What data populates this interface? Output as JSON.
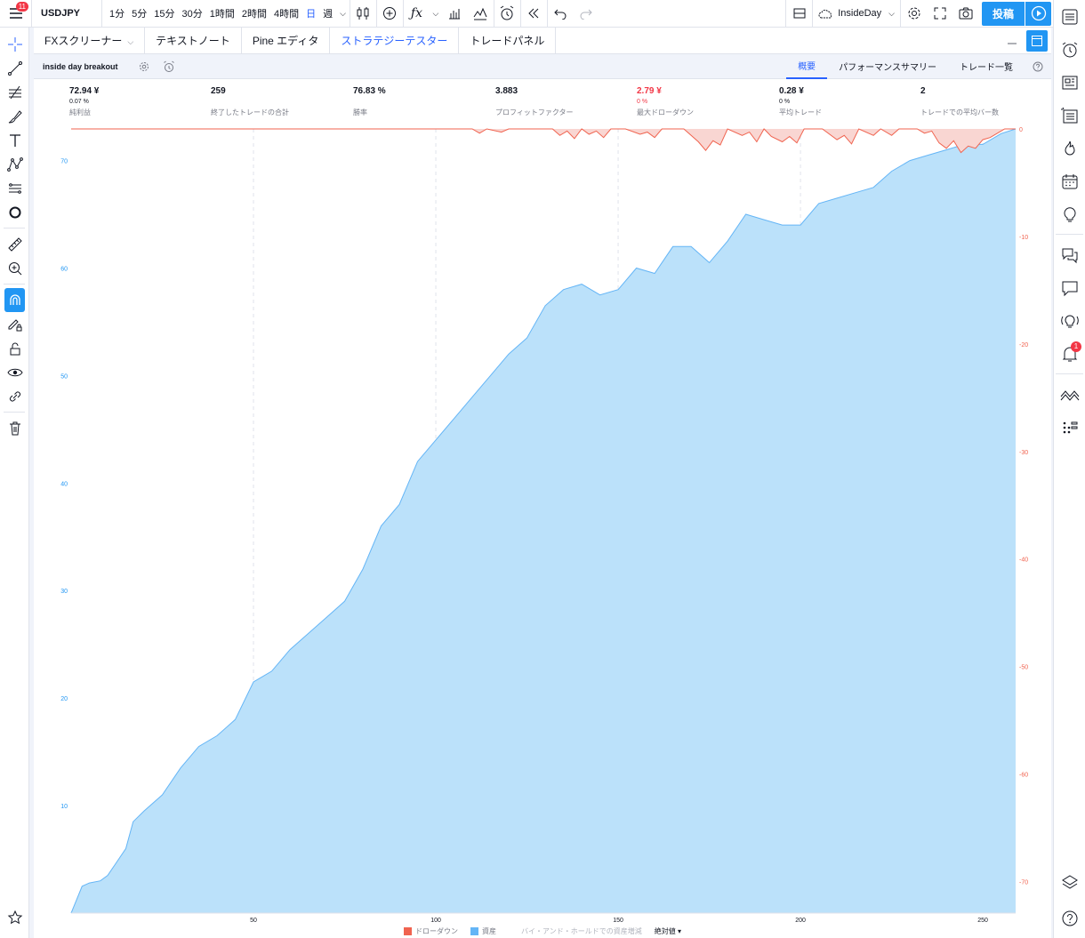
{
  "topbar": {
    "menu_badge": "11",
    "symbol": "USDJPY",
    "intervals": [
      "1分",
      "5分",
      "15分",
      "30分",
      "1時間",
      "2時間",
      "4時間",
      "日",
      "週"
    ],
    "active_interval": "日",
    "layout_name": "InsideDay",
    "publish_label": "投稿"
  },
  "panel": {
    "tabs": [
      {
        "label": "FXスクリーナー",
        "active": false,
        "dropdown": true
      },
      {
        "label": "テキストノート",
        "active": false
      },
      {
        "label": "Pine エディタ",
        "active": false
      },
      {
        "label": "ストラテジーテスター",
        "active": true
      },
      {
        "label": "トレードパネル",
        "active": false
      }
    ],
    "strategy_name": "inside day breakout",
    "subtabs": [
      {
        "label": "概要",
        "active": true
      },
      {
        "label": "パフォーマンスサマリー",
        "active": false
      },
      {
        "label": "トレード一覧",
        "active": false
      }
    ]
  },
  "stats": [
    {
      "value": "72.94 ¥",
      "sub": "0.07 %",
      "label": "純利益",
      "negative": false
    },
    {
      "value": "259",
      "sub": "",
      "label": "終了したトレードの合計",
      "negative": false
    },
    {
      "value": "76.83 %",
      "sub": "",
      "label": "勝率",
      "negative": false
    },
    {
      "value": "3.883",
      "sub": "",
      "label": "プロフィットファクター",
      "negative": false
    },
    {
      "value": "2.79 ¥",
      "sub": "0 %",
      "label": "最大ドローダウン",
      "negative": true
    },
    {
      "value": "0.28 ¥",
      "sub": "0 %",
      "label": "平均トレード",
      "negative": false
    },
    {
      "value": "2",
      "sub": "",
      "label": "トレードでの平均バー数",
      "negative": false
    }
  ],
  "legend": {
    "drawdown": "ドローダウン",
    "equity": "資産",
    "buyhold": "バイ・アンド・ホールドでの資産増減",
    "mode": "絶対値",
    "drawdown_color": "#f0634f",
    "equity_color": "#64b5f6"
  },
  "right_badge": "1",
  "chart_data": {
    "type": "area",
    "x_ticks": [
      50,
      100,
      150,
      200,
      250
    ],
    "xlim": [
      0,
      259
    ],
    "left_axis": {
      "ticks": [
        10,
        20,
        30,
        40,
        50,
        60,
        70
      ],
      "ylim": [
        0,
        72.94
      ]
    },
    "right_axis": {
      "ticks": [
        0,
        -10,
        -20,
        -30,
        -40,
        -50,
        -60,
        -70
      ],
      "ylim": [
        -72.94,
        0
      ]
    },
    "series": [
      {
        "name": "資産",
        "color": "#64b5f6",
        "points": [
          [
            0,
            0
          ],
          [
            3,
            2.5
          ],
          [
            5,
            2.8
          ],
          [
            8,
            3
          ],
          [
            10,
            3.5
          ],
          [
            12,
            4.5
          ],
          [
            15,
            6
          ],
          [
            17,
            8.5
          ],
          [
            20,
            9.5
          ],
          [
            25,
            11
          ],
          [
            30,
            13.5
          ],
          [
            35,
            15.5
          ],
          [
            40,
            16.5
          ],
          [
            45,
            18
          ],
          [
            50,
            21.5
          ],
          [
            55,
            22.5
          ],
          [
            60,
            24.5
          ],
          [
            65,
            26
          ],
          [
            70,
            27.5
          ],
          [
            75,
            29
          ],
          [
            80,
            32
          ],
          [
            85,
            36
          ],
          [
            90,
            38
          ],
          [
            95,
            42
          ],
          [
            100,
            44
          ],
          [
            105,
            46
          ],
          [
            110,
            48
          ],
          [
            115,
            50
          ],
          [
            120,
            52
          ],
          [
            125,
            53.5
          ],
          [
            130,
            56.5
          ],
          [
            135,
            58
          ],
          [
            140,
            58.5
          ],
          [
            145,
            57.5
          ],
          [
            150,
            58
          ],
          [
            155,
            60
          ],
          [
            160,
            59.5
          ],
          [
            165,
            62
          ],
          [
            170,
            62
          ],
          [
            175,
            60.5
          ],
          [
            180,
            62.5
          ],
          [
            185,
            65
          ],
          [
            190,
            64.5
          ],
          [
            195,
            64
          ],
          [
            200,
            64
          ],
          [
            205,
            66
          ],
          [
            210,
            66.5
          ],
          [
            215,
            67
          ],
          [
            220,
            67.5
          ],
          [
            225,
            69
          ],
          [
            230,
            70
          ],
          [
            235,
            70.5
          ],
          [
            240,
            71
          ],
          [
            245,
            71.5
          ],
          [
            250,
            71.5
          ],
          [
            255,
            72.5
          ],
          [
            259,
            72.94
          ]
        ]
      },
      {
        "name": "ドローダウン",
        "color": "#f0634f",
        "points": [
          [
            0,
            0
          ],
          [
            110,
            0
          ],
          [
            112,
            -0.4
          ],
          [
            114,
            0
          ],
          [
            118,
            -0.3
          ],
          [
            120,
            0
          ],
          [
            132,
            0
          ],
          [
            134,
            -0.6
          ],
          [
            136,
            -0.2
          ],
          [
            138,
            -0.9
          ],
          [
            140,
            0
          ],
          [
            142,
            -0.5
          ],
          [
            144,
            -0.2
          ],
          [
            146,
            -0.8
          ],
          [
            148,
            0
          ],
          [
            152,
            0
          ],
          [
            156,
            -0.5
          ],
          [
            158,
            -0.3
          ],
          [
            160,
            -0.8
          ],
          [
            162,
            0
          ],
          [
            168,
            0
          ],
          [
            172,
            -1.2
          ],
          [
            174,
            -2
          ],
          [
            176,
            -1.1
          ],
          [
            178,
            -1.5
          ],
          [
            180,
            0
          ],
          [
            184,
            -0.6
          ],
          [
            186,
            -0.3
          ],
          [
            188,
            -1.2
          ],
          [
            190,
            0
          ],
          [
            192,
            -0.7
          ],
          [
            195,
            -1.2
          ],
          [
            197,
            -0.7
          ],
          [
            199,
            -1.3
          ],
          [
            201,
            0
          ],
          [
            206,
            0
          ],
          [
            210,
            -1
          ],
          [
            212,
            -0.6
          ],
          [
            214,
            -1.4
          ],
          [
            216,
            0
          ],
          [
            220,
            -0.6
          ],
          [
            222,
            0
          ],
          [
            225,
            -0.6
          ],
          [
            227,
            0
          ],
          [
            232,
            0
          ],
          [
            234,
            -0.4
          ],
          [
            236,
            -0.2
          ],
          [
            238,
            -1.3
          ],
          [
            240,
            -1.8
          ],
          [
            242,
            -1.1
          ],
          [
            244,
            -2.2
          ],
          [
            246,
            -1.6
          ],
          [
            248,
            -1.8
          ],
          [
            250,
            -1
          ],
          [
            252,
            -0.8
          ],
          [
            254,
            -0.4
          ],
          [
            256,
            0
          ],
          [
            259,
            0
          ]
        ]
      }
    ]
  }
}
